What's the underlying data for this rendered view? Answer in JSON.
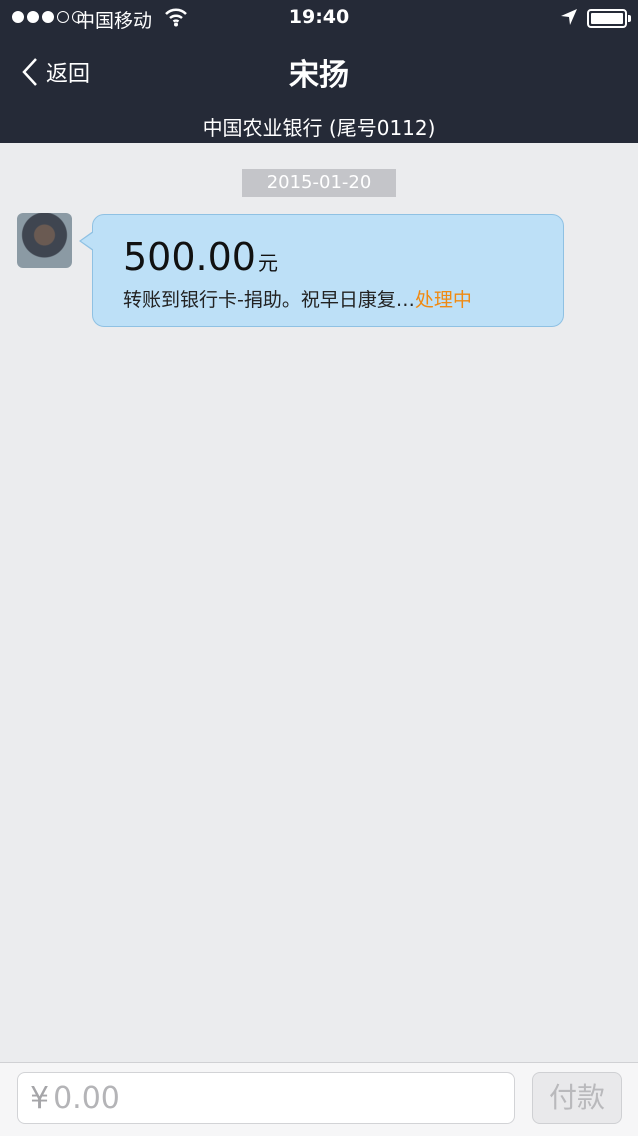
{
  "status_bar": {
    "carrier": "中国移动",
    "time": "19:40",
    "battery": 1.0,
    "icons": [
      "signal-dots-icon",
      "wifi-icon",
      "location-arrow-icon",
      "battery-icon"
    ]
  },
  "nav": {
    "back_label": "返回",
    "title": "宋扬",
    "subtitle": "中国农业银行 (尾号0112)"
  },
  "chat": {
    "date": "2015-01-20",
    "message": {
      "amount": "500.00",
      "currency_unit": "元",
      "description": "转账到银行卡-捐助。祝早日康复…",
      "status": "处理中",
      "status_color": "#f08a12"
    }
  },
  "input_bar": {
    "currency_symbol": "¥",
    "amount_placeholder": "0.00",
    "pay_label": "付款"
  },
  "colors": {
    "nav_background": "#252a37",
    "bubble_background": "#bde0f7",
    "page_background": "#ebecee"
  }
}
